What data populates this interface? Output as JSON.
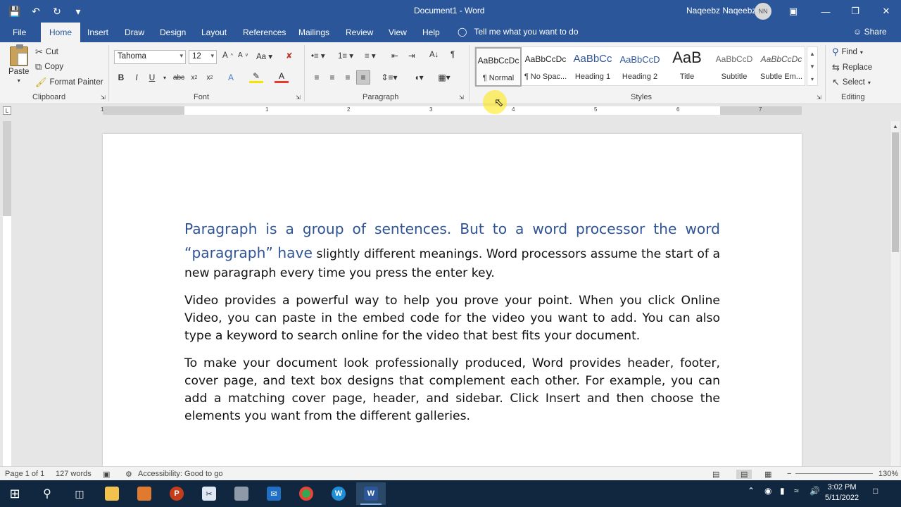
{
  "titlebar": {
    "doc_title": "Document1  -  Word",
    "user_name": "Naqeebz Naqeebz",
    "avatar_initials": "NN",
    "qat_icons": [
      "save-icon",
      "undo-icon",
      "redo-icon",
      "customize-icon"
    ],
    "window_buttons": [
      "ribbon-display-icon",
      "minimize-icon",
      "restore-icon",
      "close-icon"
    ]
  },
  "tabs": {
    "file": "File",
    "home": "Home",
    "insert": "Insert",
    "draw": "Draw",
    "design": "Design",
    "layout": "Layout",
    "references": "References",
    "mailings": "Mailings",
    "review": "Review",
    "view": "View",
    "help": "Help",
    "tellme": "Tell me what you want to do",
    "share": "Share"
  },
  "clipboard": {
    "paste": "Paste",
    "cut": "Cut",
    "copy": "Copy",
    "format_painter": "Format Painter",
    "label": "Clipboard"
  },
  "font": {
    "name": "Tahoma",
    "size": "12",
    "label": "Font"
  },
  "paragraph": {
    "label": "Paragraph"
  },
  "styles": {
    "label": "Styles",
    "items": [
      {
        "sample": "AaBbCcDc",
        "name": "¶ Normal"
      },
      {
        "sample": "AaBbCcDc",
        "name": "¶ No Spac..."
      },
      {
        "sample": "AaBbCc",
        "name": "Heading 1"
      },
      {
        "sample": "AaBbCcD",
        "name": "Heading 2"
      },
      {
        "sample": "AaB",
        "name": "Title"
      },
      {
        "sample": "AaBbCcD",
        "name": "Subtitle"
      },
      {
        "sample": "AaBbCcDc",
        "name": "Subtle Em..."
      }
    ]
  },
  "editing": {
    "find": "Find",
    "replace": "Replace",
    "select": "Select",
    "label": "Editing"
  },
  "ruler": {
    "corner": "L",
    "numbers": [
      "1",
      "1",
      "2",
      "3",
      "4",
      "5",
      "6",
      "7"
    ]
  },
  "document": {
    "p1_heading_part": "Paragraph is a group of sentences. But to a word processor the word “paragraph” have",
    "p1_rest": " slightly different meanings. Word processors assume the start of a new paragraph every time you press the enter key.",
    "p2": "Video provides a powerful way to help you prove your point. When you click Online Video, you can paste in the embed code for the video you want to add. You can also type a keyword to search online for the video that best fits your document.",
    "p3": "To make your document look professionally produced, Word provides header, footer, cover page, and text box designs that complement each other. For example, you can add a matching cover page, header, and sidebar. Click Insert and then choose the elements you want from the different galleries."
  },
  "statusbar": {
    "page": "Page 1 of 1",
    "words": "127 words",
    "accessibility": "Accessibility: Good to go",
    "zoom": "130%"
  },
  "taskbar": {
    "time": "3:02 PM",
    "date": "5/11/2022",
    "apps": [
      "start-icon",
      "search-icon",
      "task-view-icon",
      "file-explorer-icon",
      "photos-icon",
      "powerpoint-icon",
      "snip-icon",
      "app-icon",
      "mail-icon",
      "chrome-icon",
      "whiteboard-icon",
      "word-icon"
    ]
  }
}
